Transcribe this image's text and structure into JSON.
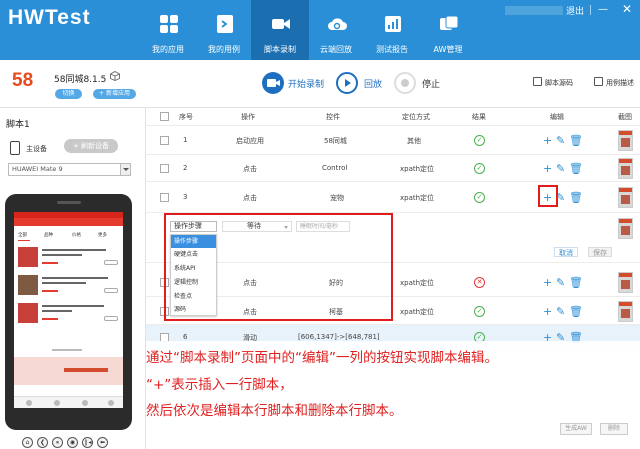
{
  "brand": {
    "logo": "HWTest"
  },
  "nav": [
    {
      "label": "我的应用",
      "icon": "grid-icon"
    },
    {
      "label": "我的用例",
      "icon": "terminal-icon"
    },
    {
      "label": "脚本录制",
      "icon": "video-icon",
      "active": true
    },
    {
      "label": "云端回放",
      "icon": "cloud-icon"
    },
    {
      "label": "测试报告",
      "icon": "report-icon"
    },
    {
      "label": "AW管理",
      "icon": "cards-icon"
    }
  ],
  "window": {
    "logout": "退出",
    "minimize": "—",
    "close": "✕"
  },
  "app": {
    "logo": "58",
    "name": "58同城8.1.5",
    "switch_label": "切换",
    "new_app_label": "+ 新增应用"
  },
  "controls": {
    "record_label": "开始录制",
    "replay_label": "回放",
    "stop_label": "停止",
    "source_label": "脚本源码",
    "usecase_label": "用例描述"
  },
  "left": {
    "script_title": "脚本1",
    "main_device_label": "主设备",
    "refresh_label": "+ 刷新设备",
    "device_name": "HUAWEI Mate 9",
    "phone_tabs": [
      "全部",
      "品种",
      "价格",
      "更多"
    ],
    "dev_buttons": [
      "⌂",
      "❮",
      "⏸",
      "◉",
      "❙◂",
      "⬅"
    ]
  },
  "table": {
    "headers": [
      "序号",
      "操作",
      "控件",
      "定位方式",
      "结果",
      "编辑",
      "截图"
    ],
    "rows": [
      {
        "no": "1",
        "op": "启动应用",
        "ctrl": "58同城",
        "loc": "其他",
        "result": "ok"
      },
      {
        "no": "2",
        "op": "点击",
        "ctrl": "Control",
        "loc": "xpath定位",
        "result": "ok"
      },
      {
        "no": "3",
        "op": "点击",
        "ctrl": "宠物",
        "loc": "xpath定位",
        "result": "ok"
      },
      {
        "no": "",
        "op": "点击",
        "ctrl": "好的",
        "loc": "xpath定位",
        "result": "err"
      },
      {
        "no": "",
        "op": "点击",
        "ctrl": "柯基",
        "loc": "xpath定位",
        "result": "ok"
      },
      {
        "no": "6",
        "op": "滑动",
        "ctrl": "[606,1347]->[648,781]",
        "loc": "",
        "result": "ok"
      }
    ]
  },
  "editor": {
    "select_value": "操作步骤",
    "eq_value": "等待",
    "wait_placeholder": "睡眠时间/毫秒",
    "cancel_label": "取消",
    "save_label": "保存",
    "options": [
      "操作步骤",
      "硬键点击",
      "系统API",
      "逻辑控制",
      "检查点",
      "源码"
    ]
  },
  "annotation": {
    "line1": "通过“脚本录制”页面中的“编辑”一列的按钮实现脚本编辑。",
    "line2": "“+”表示插入一行脚本，",
    "line3": "然后依次是编辑本行脚本和删除本行脚本。"
  },
  "footer": {
    "generate_label": "生成AW",
    "delete_label": "删除"
  },
  "colors": {
    "primary": "#2a8fd6",
    "nav_active": "#1b6fb0",
    "highlight": "#e11c1c",
    "success": "#4caf50",
    "error": "#e53935"
  }
}
